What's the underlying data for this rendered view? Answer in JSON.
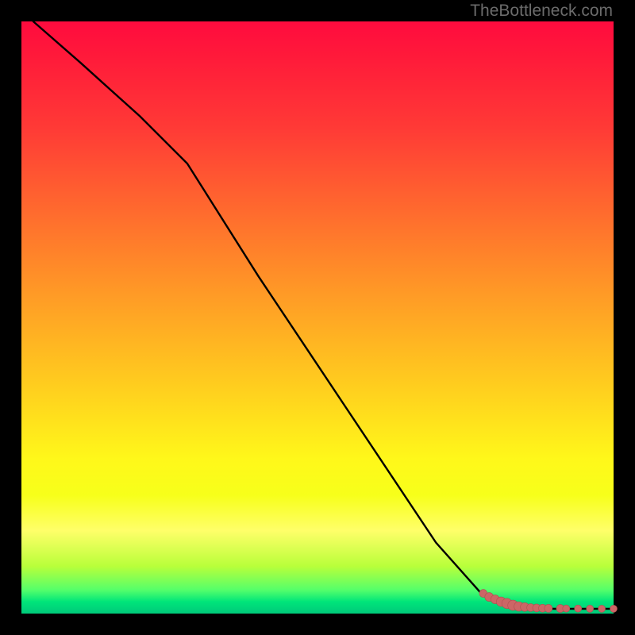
{
  "watermark": "TheBottleneck.com",
  "colors": {
    "frame": "#000000",
    "line": "#000000",
    "dot_fill": "#cc6666",
    "dot_stroke": "#b05050"
  },
  "chart_data": {
    "type": "line",
    "title": "",
    "xlabel": "",
    "ylabel": "",
    "xlim": [
      0,
      100
    ],
    "ylim": [
      0,
      100
    ],
    "grid": false,
    "legend": false,
    "series": [
      {
        "name": "bottleneck-curve",
        "x": [
          2,
          10,
          20,
          28,
          40,
          50,
          60,
          70,
          78,
          82,
          84,
          86,
          88,
          90,
          92,
          94,
          96,
          98,
          100
        ],
        "y": [
          100,
          93,
          84,
          76,
          57,
          42,
          27,
          12,
          3,
          1.5,
          1.2,
          1.0,
          0.9,
          0.8,
          0.8,
          0.8,
          0.8,
          0.8,
          0.8
        ]
      }
    ],
    "points": {
      "name": "highlight-dots",
      "x": [
        78,
        79,
        80,
        81,
        82,
        83,
        84,
        85,
        86,
        87,
        88,
        89,
        91,
        92,
        94,
        96,
        98,
        100
      ],
      "y": [
        3.4,
        2.8,
        2.4,
        2.0,
        1.7,
        1.4,
        1.2,
        1.1,
        1.0,
        0.95,
        0.9,
        0.88,
        0.86,
        0.85,
        0.84,
        0.83,
        0.82,
        0.82
      ],
      "r": [
        5,
        5.5,
        5.5,
        6,
        6.5,
        6.5,
        6,
        5.5,
        5,
        5,
        5,
        5,
        5,
        4.5,
        4.5,
        4.5,
        4.5,
        4.5
      ]
    }
  }
}
